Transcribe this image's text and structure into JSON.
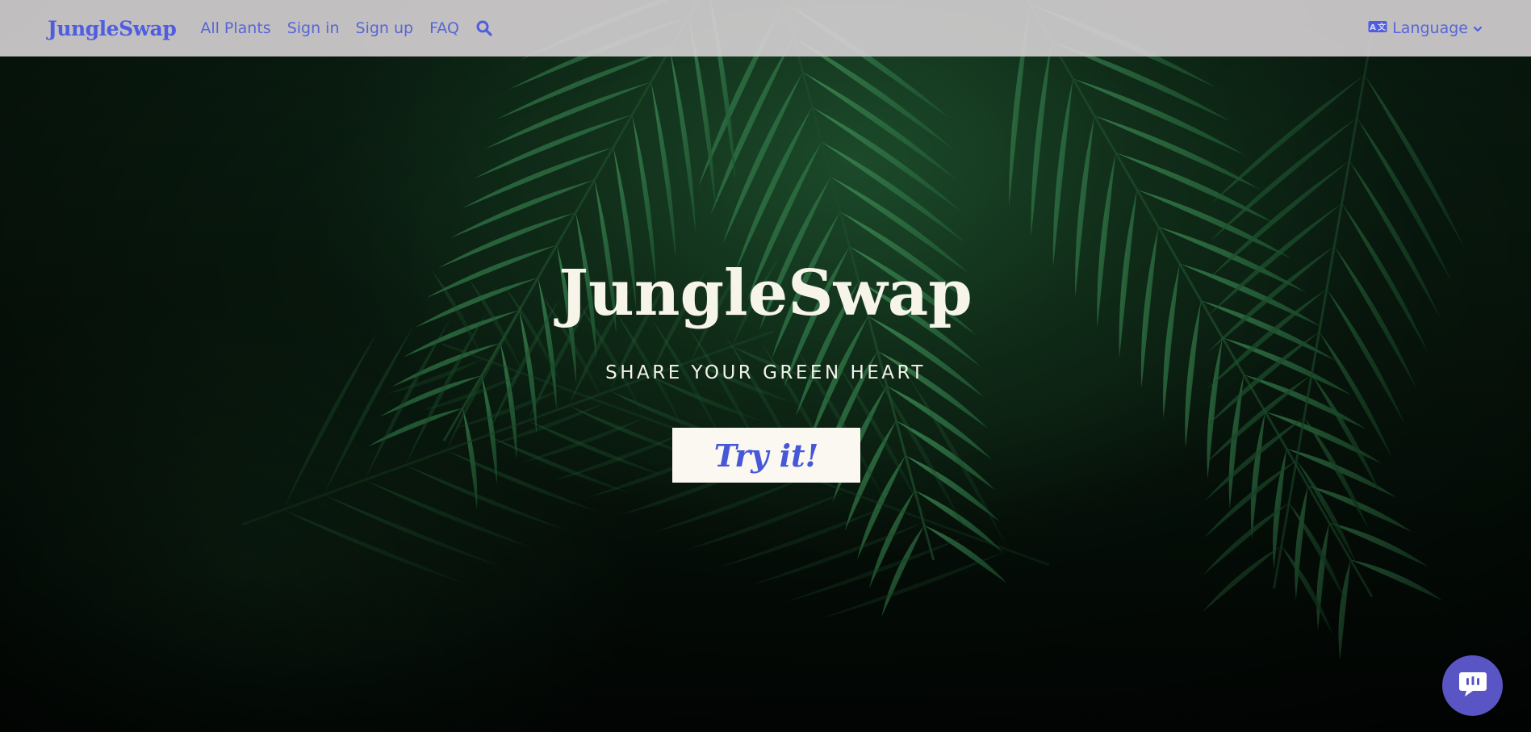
{
  "navbar": {
    "brand": "JungleSwap",
    "links": [
      "All Plants",
      "Sign in",
      "Sign up",
      "FAQ"
    ],
    "search_icon": "search-icon",
    "language_label": "Language",
    "language_icon": "translate-icon"
  },
  "hero": {
    "title": "JungleSwap",
    "subtitle": "SHARE YOUR GREEN HEART",
    "cta_label": "Try it!"
  },
  "chat": {
    "icon": "chat-bubble-icon"
  },
  "colors": {
    "accent": "#4f5de0",
    "navbar_bg": "#d6d2d4",
    "cta_bg": "#fbf8f1",
    "chat_bg": "#5a55c4",
    "hero_text": "#f7f4ea"
  }
}
